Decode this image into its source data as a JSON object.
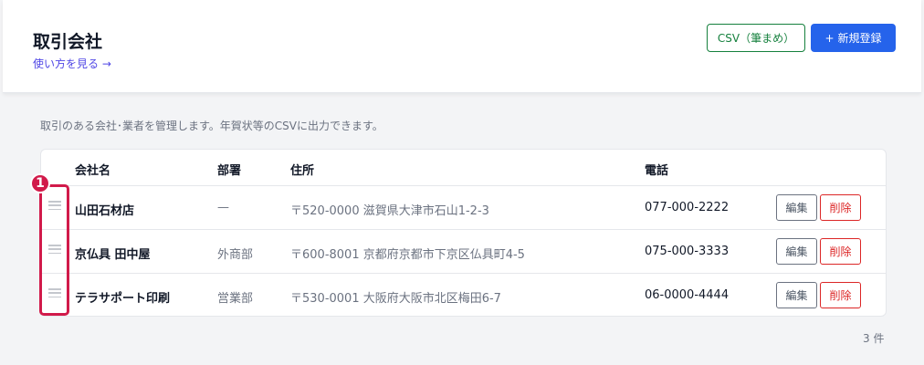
{
  "header": {
    "title": "取引会社",
    "howto_link": "使い方を見る →",
    "csv_button": "CSV（筆まめ）",
    "new_button_icon": "+",
    "new_button": "新規登録"
  },
  "description": "取引のある会社･業者を管理します。年賀状等のCSVに出力できます。",
  "table": {
    "columns": {
      "name": "会社名",
      "dept": "部署",
      "address": "住所",
      "tel": "電話"
    },
    "rows": [
      {
        "name": "山田石材店",
        "dept": "—",
        "address": "〒520-0000 滋賀県大津市石山1-2-3",
        "tel": "077-000-2222",
        "edit": "編集",
        "delete": "削除"
      },
      {
        "name": "京仏具 田中屋",
        "dept": "外商部",
        "address": "〒600-8001 京都府京都市下京区仏具町4-5",
        "tel": "075-000-3333",
        "edit": "編集",
        "delete": "削除"
      },
      {
        "name": "テラサポート印刷",
        "dept": "営業部",
        "address": "〒530-0001 大阪府大阪市北区梅田6-7",
        "tel": "06-0000-4444",
        "edit": "編集",
        "delete": "削除"
      }
    ]
  },
  "annotation": {
    "number": "1",
    "color": "#d11a4a"
  },
  "count": "3 件",
  "colors": {
    "primary": "#2563eb",
    "csv": "#15803d",
    "danger": "#dc2626",
    "link": "#4f46e5"
  }
}
